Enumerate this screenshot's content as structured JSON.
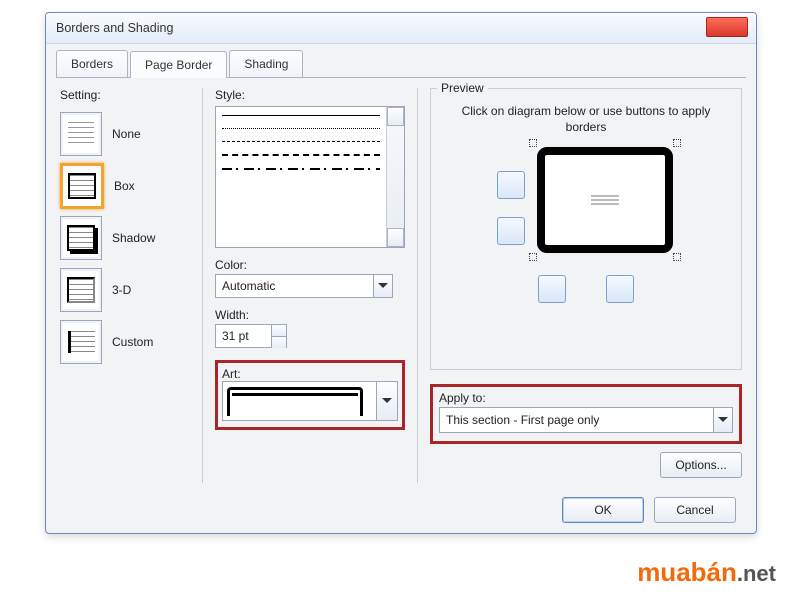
{
  "window": {
    "title": "Borders and Shading"
  },
  "tabs": {
    "borders": "Borders",
    "page_border": "Page Border",
    "shading": "Shading"
  },
  "setting": {
    "label": "Setting:",
    "none": "None",
    "box": "Box",
    "shadow": "Shadow",
    "threed": "3-D",
    "custom": "Custom"
  },
  "style": {
    "label": "Style:",
    "color_label": "Color:",
    "color_value": "Automatic",
    "width_label": "Width:",
    "width_value": "31 pt",
    "art_label": "Art:"
  },
  "preview": {
    "label": "Preview",
    "hint": "Click on diagram below or use buttons to apply borders"
  },
  "apply": {
    "label": "Apply to:",
    "value": "This section - First page only"
  },
  "buttons": {
    "options": "Options...",
    "ok": "OK",
    "cancel": "Cancel"
  },
  "brand": {
    "main": "muabán",
    "suffix": ".net"
  }
}
